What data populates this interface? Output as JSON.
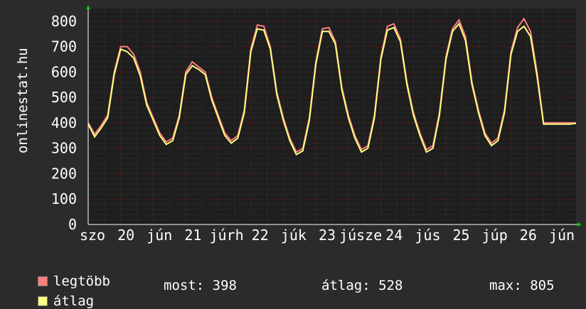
{
  "chart_data": {
    "type": "line",
    "ylabel": "onlinestat.hu",
    "ylim": [
      0,
      850
    ],
    "yticks": [
      0,
      100,
      200,
      300,
      400,
      500,
      600,
      700,
      800
    ],
    "grid": true,
    "x_tick_labels": [
      "szo",
      "20",
      "jún",
      "21",
      "júrh",
      "22",
      "júk",
      "23",
      "júsze",
      "24",
      "jús",
      "25",
      "júp",
      "26",
      "jún"
    ],
    "series": [
      {
        "name": "legtöbb",
        "color": "#ff7f7f",
        "x": [
          0,
          0.1,
          0.2,
          0.3,
          0.4,
          0.5,
          0.6,
          0.7,
          0.8,
          0.9,
          1.0,
          1.1,
          1.2,
          1.3,
          1.4,
          1.5,
          1.6,
          1.7,
          1.8,
          1.9,
          2.0,
          2.1,
          2.2,
          2.3,
          2.4,
          2.5,
          2.6,
          2.7,
          2.8,
          2.9,
          3.0,
          3.1,
          3.2,
          3.3,
          3.4,
          3.5,
          3.6,
          3.7,
          3.8,
          3.9,
          4.0,
          4.1,
          4.2,
          4.3,
          4.4,
          4.5,
          4.6,
          4.7,
          4.8,
          4.9,
          5.0,
          5.1,
          5.2,
          5.3,
          5.4,
          5.5,
          5.6,
          5.7,
          5.8,
          5.9,
          6.0,
          6.1,
          6.2,
          6.3,
          6.4,
          6.5,
          6.6,
          6.7,
          6.8,
          6.9,
          7.0,
          7.1,
          7.2,
          7.3,
          7.4,
          7.5
        ],
        "y": [
          400,
          355,
          390,
          430,
          600,
          700,
          700,
          670,
          600,
          480,
          420,
          360,
          325,
          340,
          430,
          600,
          640,
          620,
          600,
          500,
          430,
          360,
          330,
          350,
          450,
          690,
          785,
          780,
          700,
          520,
          420,
          340,
          285,
          300,
          420,
          640,
          770,
          775,
          720,
          540,
          430,
          350,
          295,
          310,
          430,
          660,
          780,
          790,
          730,
          560,
          440,
          360,
          295,
          310,
          440,
          660,
          770,
          805,
          740,
          560,
          450,
          360,
          320,
          340,
          450,
          680,
          775,
          810,
          760,
          600,
          400,
          400,
          400,
          400,
          400,
          400
        ]
      },
      {
        "name": "átlag",
        "color": "#ffff80",
        "x": [
          0,
          0.1,
          0.2,
          0.3,
          0.4,
          0.5,
          0.6,
          0.7,
          0.8,
          0.9,
          1.0,
          1.1,
          1.2,
          1.3,
          1.4,
          1.5,
          1.6,
          1.7,
          1.8,
          1.9,
          2.0,
          2.1,
          2.2,
          2.3,
          2.4,
          2.5,
          2.6,
          2.7,
          2.8,
          2.9,
          3.0,
          3.1,
          3.2,
          3.3,
          3.4,
          3.5,
          3.6,
          3.7,
          3.8,
          3.9,
          4.0,
          4.1,
          4.2,
          4.3,
          4.4,
          4.5,
          4.6,
          4.7,
          4.8,
          4.9,
          5.0,
          5.1,
          5.2,
          5.3,
          5.4,
          5.5,
          5.6,
          5.7,
          5.8,
          5.9,
          6.0,
          6.1,
          6.2,
          6.3,
          6.4,
          6.5,
          6.6,
          6.7,
          6.8,
          6.9,
          7.0,
          7.1,
          7.2,
          7.3,
          7.4,
          7.5
        ],
        "y": [
          395,
          345,
          380,
          420,
          590,
          690,
          680,
          655,
          585,
          470,
          410,
          350,
          315,
          330,
          420,
          590,
          625,
          610,
          590,
          490,
          420,
          350,
          320,
          340,
          440,
          680,
          770,
          765,
          690,
          510,
          410,
          330,
          275,
          290,
          410,
          630,
          760,
          760,
          710,
          530,
          420,
          340,
          285,
          300,
          420,
          650,
          765,
          775,
          720,
          550,
          430,
          350,
          285,
          300,
          430,
          650,
          760,
          790,
          725,
          550,
          440,
          350,
          310,
          330,
          440,
          670,
          760,
          780,
          740,
          585,
          395,
          395,
          395,
          395,
          395,
          398
        ]
      }
    ]
  },
  "legend": {
    "items": [
      {
        "label": "legtöbb",
        "color": "#ff7f7f"
      },
      {
        "label": "átlag",
        "color": "#ffff80"
      }
    ]
  },
  "stats": {
    "most": "most: 398",
    "atlag": "átlag: 528",
    "max": "max: 805"
  }
}
